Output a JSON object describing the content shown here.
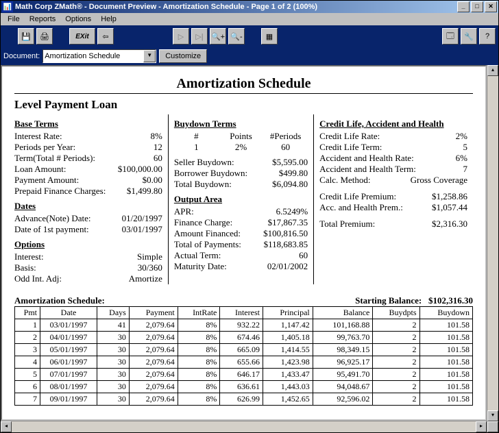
{
  "title": "Math Corp ZMath® - Document Preview - Amortization Schedule - Page  1 of  2  (100%)",
  "menu": {
    "file": "File",
    "reports": "Reports",
    "options": "Options",
    "help": "Help"
  },
  "toolbar": {
    "save": "💾",
    "print": "🖨",
    "exit": "EXit",
    "back": "⇦",
    "play": "▷",
    "end": "▷|",
    "zoomin": "🔍+",
    "zoomout": "🔍-",
    "calc": "▦",
    "props": "🗔",
    "tool": "🔧",
    "help": "?"
  },
  "docbar": {
    "label": "Document:",
    "value": "Amortization Schedule",
    "customize": "Customize"
  },
  "doc": {
    "heading": "Amortization Schedule",
    "subtitle": "Level Payment Loan",
    "base": {
      "title": "Base Terms",
      "rows": [
        {
          "l": "Interest Rate:",
          "v": "8%"
        },
        {
          "l": "Periods per Year:",
          "v": "12"
        },
        {
          "l": "Term(Total # Periods):",
          "v": "60"
        },
        {
          "l": "Loan Amount:",
          "v": "$100,000.00"
        },
        {
          "l": "Payment Amount:",
          "v": "$0.00"
        },
        {
          "l": "Prepaid Finance Charges:",
          "v": "$1,499.80"
        }
      ]
    },
    "dates": {
      "title": "Dates",
      "rows": [
        {
          "l": "Advance(Note) Date:",
          "v": "01/20/1997"
        },
        {
          "l": "Date of 1st payment:",
          "v": "03/01/1997"
        }
      ]
    },
    "options": {
      "title": "Options",
      "rows": [
        {
          "l": "Interest:",
          "v": "Simple"
        },
        {
          "l": "Basis:",
          "v": "30/360"
        },
        {
          "l": "Odd Int. Adj:",
          "v": "Amortize"
        }
      ]
    },
    "buydown": {
      "title": "Buydown Terms",
      "hdr": {
        "a": "#",
        "b": "Points",
        "c": "#Periods"
      },
      "line": {
        "a": "1",
        "b": "2%",
        "c": "60"
      },
      "rows": [
        {
          "l": "Seller Buydown:",
          "v": "$5,595.00"
        },
        {
          "l": "Borrower Buydown:",
          "v": "$499.80"
        },
        {
          "l": "Total Buydown:",
          "v": "$6,094.80"
        }
      ]
    },
    "output": {
      "title": "Output Area",
      "rows": [
        {
          "l": "APR:",
          "v": "6.5249%"
        },
        {
          "l": "Finance Charge:",
          "v": "$17,867.35"
        },
        {
          "l": "Amount Financed:",
          "v": "$100,816.50"
        },
        {
          "l": "Total of Payments:",
          "v": "$118,683.85"
        },
        {
          "l": "Actual Term:",
          "v": "60"
        },
        {
          "l": "Maturity Date:",
          "v": "02/01/2002"
        }
      ]
    },
    "credit": {
      "title": "Credit Life, Accident and Health",
      "rows": [
        {
          "l": "Credit Life Rate:",
          "v": "2%"
        },
        {
          "l": "Credit Life Term:",
          "v": "5"
        },
        {
          "l": "Accident and Health Rate:",
          "v": "6%"
        },
        {
          "l": "Accident and Health Term:",
          "v": "7"
        },
        {
          "l": "Calc. Method:",
          "v": "Gross Coverage"
        }
      ],
      "rows2": [
        {
          "l": "Credit Life Premium:",
          "v": "$1,258.86"
        },
        {
          "l": "Acc. and Health Prem.:",
          "v": "$1,057.44"
        }
      ],
      "rows3": [
        {
          "l": "Total Premium:",
          "v": "$2,316.30"
        }
      ]
    },
    "sched": {
      "title": "Amortization Schedule:",
      "startbal_label": "Starting Balance:",
      "startbal": "$102,316.30",
      "headers": [
        "Pmt",
        "Date",
        "Days",
        "Payment",
        "IntRate",
        "Interest",
        "Principal",
        "Balance",
        "Buydpts",
        "Buydown"
      ],
      "rows": [
        [
          "1",
          "03/01/1997",
          "41",
          "2,079.64",
          "8%",
          "932.22",
          "1,147.42",
          "101,168.88",
          "2",
          "101.58"
        ],
        [
          "2",
          "04/01/1997",
          "30",
          "2,079.64",
          "8%",
          "674.46",
          "1,405.18",
          "99,763.70",
          "2",
          "101.58"
        ],
        [
          "3",
          "05/01/1997",
          "30",
          "2,079.64",
          "8%",
          "665.09",
          "1,414.55",
          "98,349.15",
          "2",
          "101.58"
        ],
        [
          "4",
          "06/01/1997",
          "30",
          "2,079.64",
          "8%",
          "655.66",
          "1,423.98",
          "96,925.17",
          "2",
          "101.58"
        ],
        [
          "5",
          "07/01/1997",
          "30",
          "2,079.64",
          "8%",
          "646.17",
          "1,433.47",
          "95,491.70",
          "2",
          "101.58"
        ],
        [
          "6",
          "08/01/1997",
          "30",
          "2,079.64",
          "8%",
          "636.61",
          "1,443.03",
          "94,048.67",
          "2",
          "101.58"
        ],
        [
          "7",
          "09/01/1997",
          "30",
          "2,079.64",
          "8%",
          "626.99",
          "1,452.65",
          "92,596.02",
          "2",
          "101.58"
        ]
      ]
    }
  }
}
